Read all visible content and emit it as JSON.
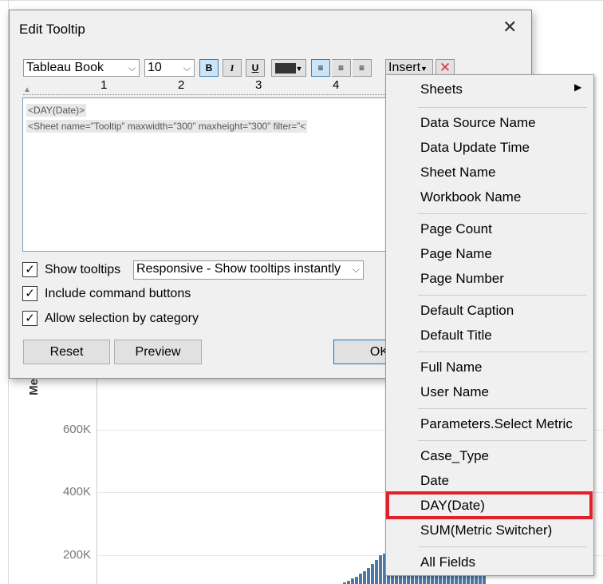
{
  "background_chart": {
    "axis_label": "Me",
    "ticks": [
      "600K",
      "400K",
      "200K"
    ],
    "bar_color": "#4e79a7",
    "bar_values_k": [
      105,
      108,
      112,
      118,
      125,
      132,
      140,
      150,
      160,
      172,
      185,
      200,
      205,
      208,
      210,
      212,
      214,
      215,
      216,
      218,
      220,
      222,
      223,
      225,
      226,
      228,
      230,
      231,
      232,
      233,
      234,
      235,
      236,
      237,
      238,
      240,
      241,
      242
    ]
  },
  "dialog": {
    "title": "Edit Tooltip",
    "font": "Tableau Book",
    "size": "10",
    "bold": "B",
    "italic": "I",
    "underline": "U",
    "insert_label": "Insert",
    "ruler": [
      "1",
      "2",
      "3",
      "4"
    ],
    "text_lines": [
      "<DAY(Date)>",
      "<Sheet name=”Tooltip” maxwidth=”300” maxheight=”300” filter=”<"
    ],
    "show_tooltips": {
      "label": "Show tooltips",
      "checked": true
    },
    "tooltip_mode": "Responsive - Show tooltips instantly",
    "include_buttons": {
      "label": "Include command buttons",
      "checked": true
    },
    "allow_selection": {
      "label": "Allow selection by category",
      "checked": true
    },
    "reset": "Reset",
    "preview": "Preview",
    "ok": "OK"
  },
  "menu": {
    "groups": [
      [
        "Sheets"
      ],
      [
        "Data Source Name",
        "Data Update Time",
        "Sheet Name",
        "Workbook Name"
      ],
      [
        "Page Count",
        "Page Name",
        "Page Number"
      ],
      [
        "Default Caption",
        "Default Title"
      ],
      [
        "Full Name",
        "User Name"
      ],
      [
        "Parameters.Select Metric"
      ],
      [
        "Case_Type",
        "Date",
        "DAY(Date)",
        "SUM(Metric Switcher)"
      ],
      [
        "All Fields"
      ]
    ],
    "highlighted": "DAY(Date)",
    "highlight_color": "#e0202a"
  }
}
